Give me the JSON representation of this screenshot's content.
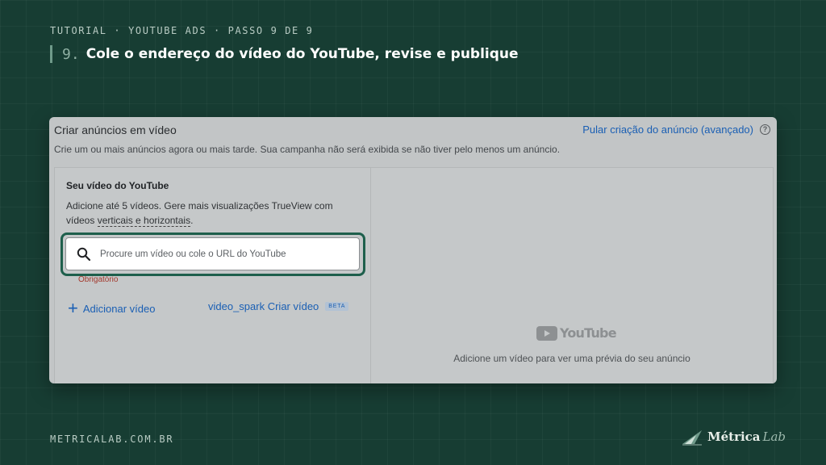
{
  "header": {
    "kicker": "TUTORIAL · YOUTUBE ADS · PASSO 9 DE 9",
    "step_number": "9.",
    "title": "Cole o endereço do vídeo do YouTube, revise e publique"
  },
  "panel": {
    "title": "Criar anúncios em vídeo",
    "subtitle": "Crie um ou mais anúncios agora ou mais tarde. Sua campanha não será exibida se não tiver pelo menos um anúncio.",
    "skip_link": "Pular criação do anúncio (avançado)",
    "help_icon": "?",
    "left": {
      "title": "Seu vídeo do YouTube",
      "desc_prefix": "Adicione até 5 vídeos. Gere mais visualizações TrueView com vídeos ",
      "desc_link": "verticais e horizontais",
      "desc_suffix": ".",
      "required": "Obrigatório",
      "search_placeholder": "Procure um vídeo ou cole o URL do YouTube",
      "search_value": "",
      "add_video_label": "Adicionar vídeo",
      "create_video_label": "video_spark Criar vídeo",
      "beta_badge": "BETA"
    },
    "right": {
      "logo_text": "YouTube",
      "preview_text": "Adicione um vídeo para ver uma prévia do seu anúncio"
    }
  },
  "footer": {
    "url": "METRICALAB.COM.BR",
    "brand_name": "Métrica",
    "brand_suffix": "Lab"
  },
  "colors": {
    "background": "#173d33",
    "accent_green": "#1e5f4c",
    "link_blue": "#1a5fb4"
  },
  "icons": {
    "search": "search-icon",
    "plus": "plus-icon",
    "help": "help-icon",
    "youtube_play": "youtube-play-icon",
    "brand": "metrica-logo-icon"
  }
}
